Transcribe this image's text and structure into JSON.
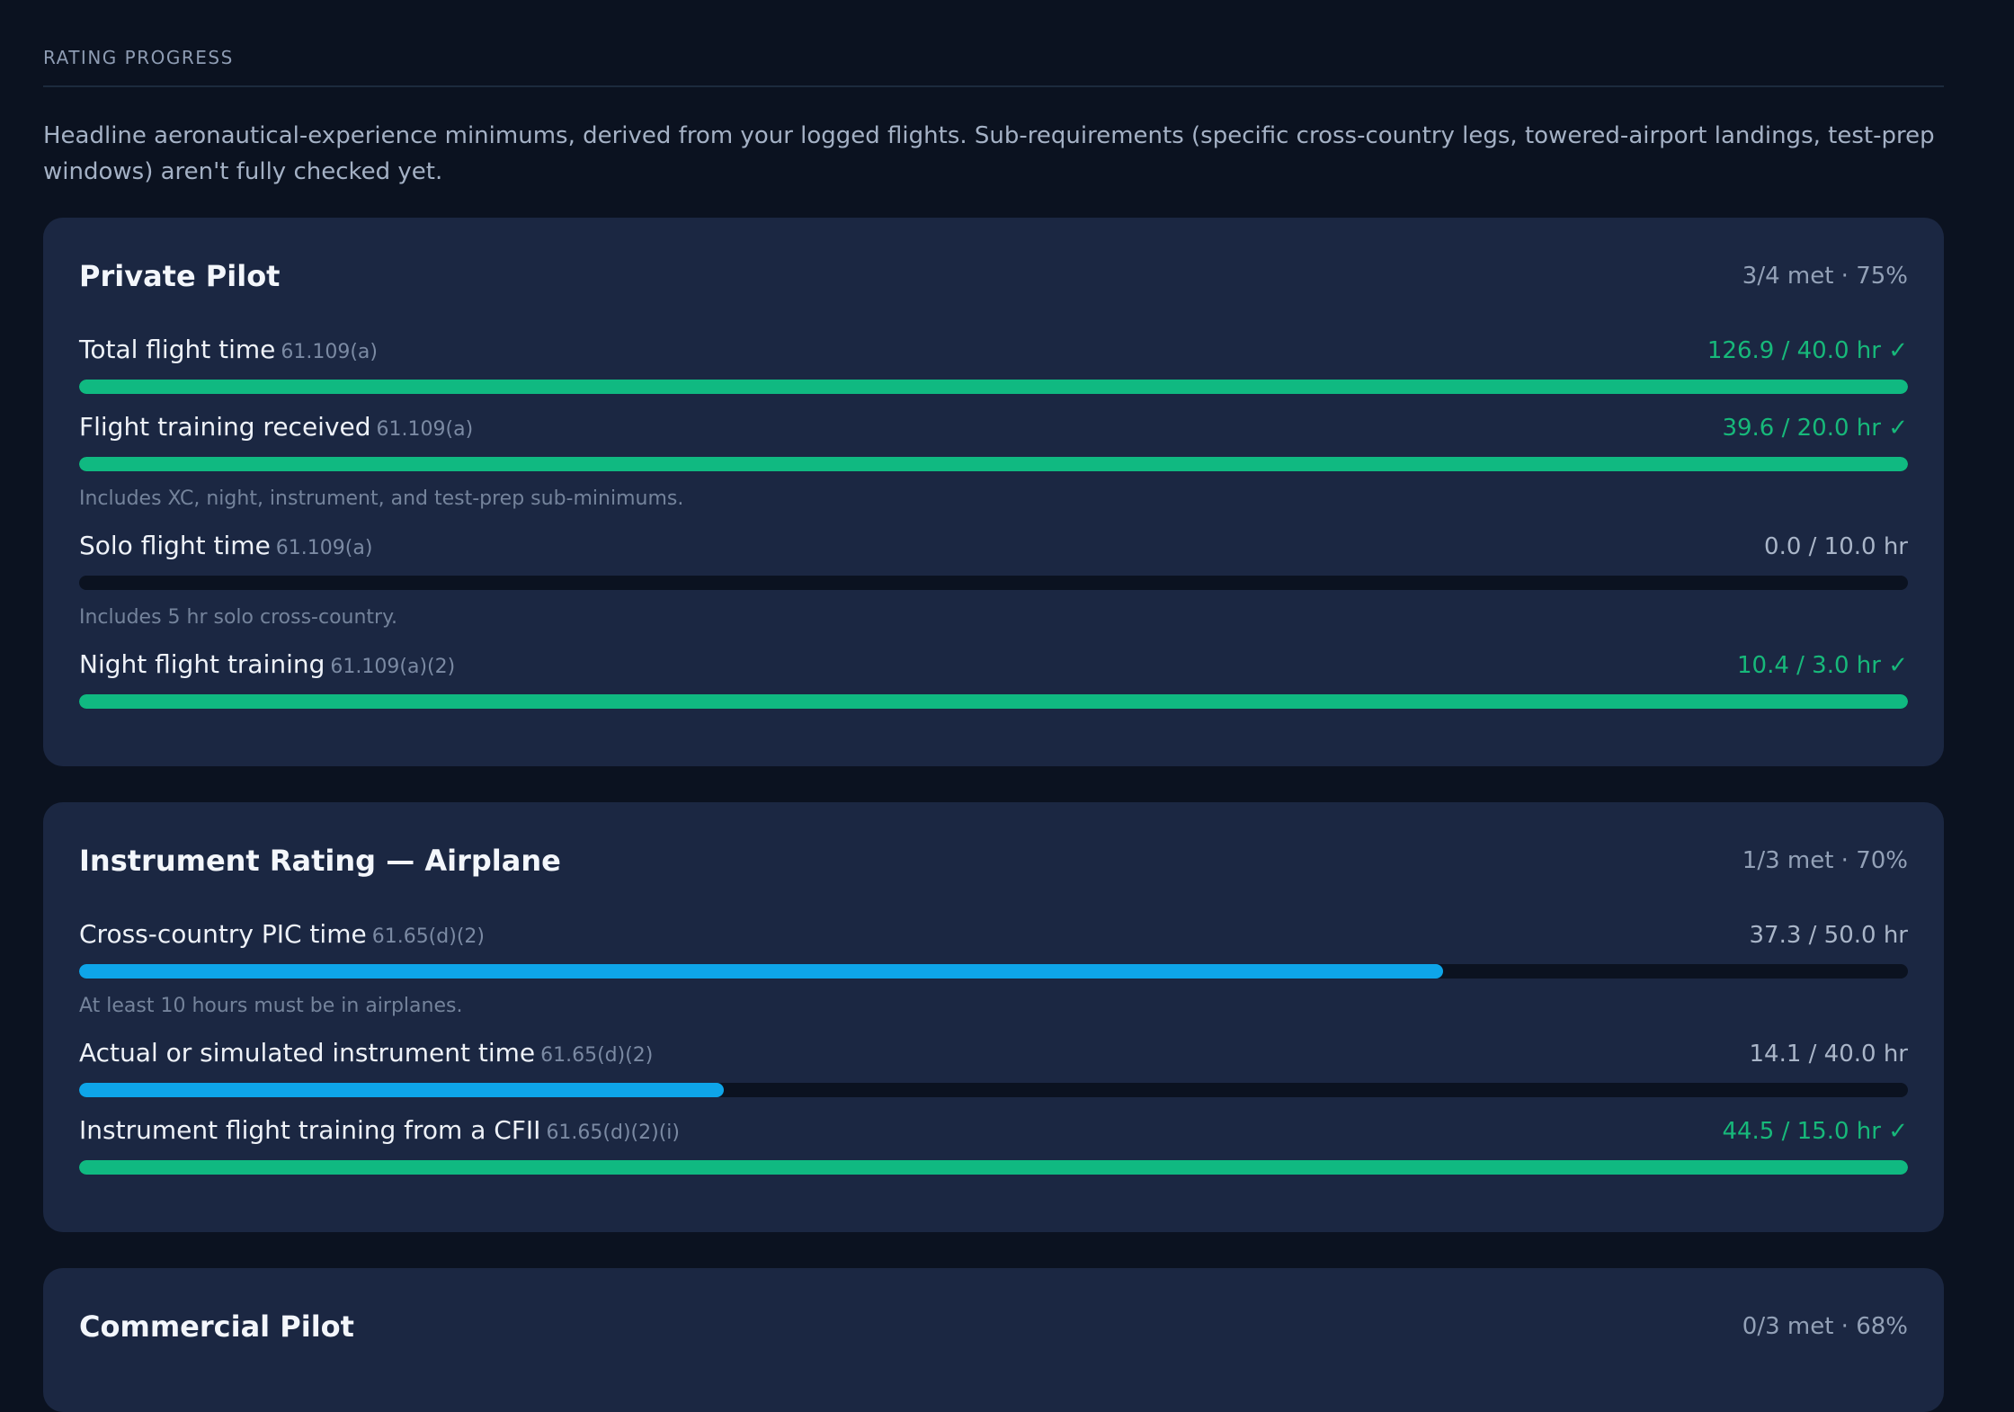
{
  "section": {
    "title": "RATING PROGRESS",
    "intro": "Headline aeronautical-experience minimums, derived from your logged flights. Sub-requirements (specific cross-country legs, towered-airport landings, test-prep windows) aren't fully checked yet."
  },
  "ratings": [
    {
      "title": "Private Pilot",
      "summary": "3/4 met · 75%",
      "requirements": [
        {
          "label": "Total flight time",
          "code": "61.109(a)",
          "value": "126.9 / 40.0 hr ✓",
          "met": true,
          "progress": 1.0,
          "note": ""
        },
        {
          "label": "Flight training received",
          "code": "61.109(a)",
          "value": "39.6 / 20.0 hr ✓",
          "met": true,
          "progress": 1.0,
          "note": "Includes XC, night, instrument, and test-prep sub-minimums."
        },
        {
          "label": "Solo flight time",
          "code": "61.109(a)",
          "value": "0.0 / 10.0 hr",
          "met": false,
          "progress": 0.0,
          "note": "Includes 5 hr solo cross-country."
        },
        {
          "label": "Night flight training",
          "code": "61.109(a)(2)",
          "value": "10.4 / 3.0 hr ✓",
          "met": true,
          "progress": 1.0,
          "note": ""
        }
      ]
    },
    {
      "title": "Instrument Rating — Airplane",
      "summary": "1/3 met · 70%",
      "requirements": [
        {
          "label": "Cross-country PIC time",
          "code": "61.65(d)(2)",
          "value": "37.3 / 50.0 hr",
          "met": false,
          "progress": 0.746,
          "note": "At least 10 hours must be in airplanes."
        },
        {
          "label": "Actual or simulated instrument time",
          "code": "61.65(d)(2)",
          "value": "14.1 / 40.0 hr",
          "met": false,
          "progress": 0.3525,
          "note": ""
        },
        {
          "label": "Instrument flight training from a CFII",
          "code": "61.65(d)(2)(i)",
          "value": "44.5 / 15.0 hr ✓",
          "met": true,
          "progress": 1.0,
          "note": ""
        }
      ]
    },
    {
      "title": "Commercial Pilot",
      "summary": "0/3 met · 68%",
      "requirements": []
    }
  ],
  "colors": {
    "met": "#10b981",
    "progress": "#0ea5e9",
    "track": "#0b1220"
  }
}
